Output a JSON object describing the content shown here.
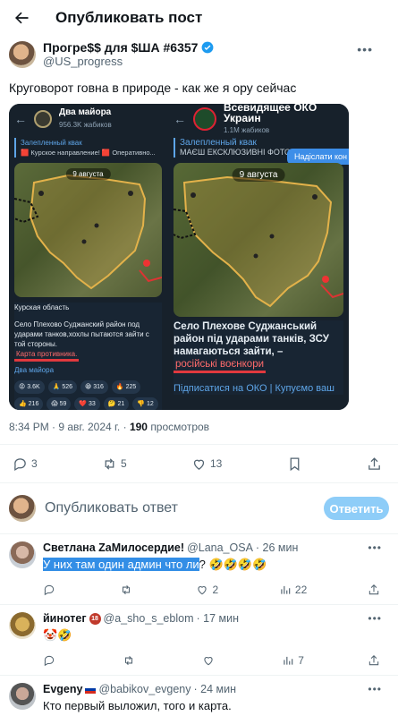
{
  "header": {
    "title": "Опубликовать пост"
  },
  "post": {
    "author_name": "Прогре$$ для $ША #6357",
    "author_handle": "@US_progress",
    "text": "Круговорот говна в природе - как же я ору сейчас",
    "timestamp": "8:34 PM · 9 авг. 2024 г.",
    "views_count": "190",
    "views_label": "просмотров",
    "stats": {
      "replies": "3",
      "reposts": "5",
      "likes": "13"
    }
  },
  "media": {
    "left": {
      "channel_name": "Два майора",
      "channel_subs": "956.3K жабиков",
      "pinned_title": "Залепленный квак",
      "pinned_snippet": "🟥 Курское направление! 🟥 Оперативно...",
      "map_date": "9 августа",
      "region": "Курская область",
      "body": "Село Плехово Суджанский район под ударами танков,хохлы пытаются зайти с той стороны.",
      "highlight": "Карта противника.",
      "signature": "Два майора",
      "reactions": [
        "😡 3.6K",
        "🙏 526",
        "😁 316",
        "🔥 225",
        "👍 216",
        "😱 59",
        "❤️ 33",
        "🤔 21",
        "👎 12"
      ]
    },
    "right": {
      "channel_name": "Всевидящее ОКО Украин",
      "channel_subs": "1.1M жабиков",
      "pinned_title": "Залепленный квак",
      "pinned_snippet": "МАЄШ ЕКСКЛЮЗИВНІ ФОТО...",
      "write_button": "Надіслати кон",
      "map_date": "9 августа",
      "body": "Село Плехове Суджанський район під ударами танків, ЗСУ намагаються зайти, –",
      "highlight": "російські воєнкори",
      "subscribe": "Підписатися на ОКО | Купуємо ваш"
    }
  },
  "reply_box": {
    "placeholder": "Опубликовать ответ",
    "button": "Ответить"
  },
  "comments": [
    {
      "name": "Светлана ZаМилосердие!",
      "handle": "@Lana_OSA",
      "time": "· 26 мин",
      "text_selected": "У них там один админ что ли",
      "text_rest": "? 🤣🤣🤣🤣",
      "replies": "",
      "reposts": "",
      "likes": "2",
      "views": "22"
    },
    {
      "name": "йинотег",
      "badge": "18",
      "handle": "@a_sho_s_eblom",
      "time": "· 17 мин",
      "text": "🤡🤣",
      "replies": "",
      "reposts": "",
      "likes": "",
      "views": "7"
    },
    {
      "name": "Evgeny",
      "handle": "@babikov_evgeny",
      "time": "· 24 мин",
      "text": "Кто первый выложил, того и карта.",
      "replies": "",
      "reposts": "",
      "likes": "1",
      "views": "9"
    }
  ],
  "colors": {
    "accent": "#1d9bf0",
    "reply_button": "#8ecdf8",
    "selection": "#338ee6"
  }
}
